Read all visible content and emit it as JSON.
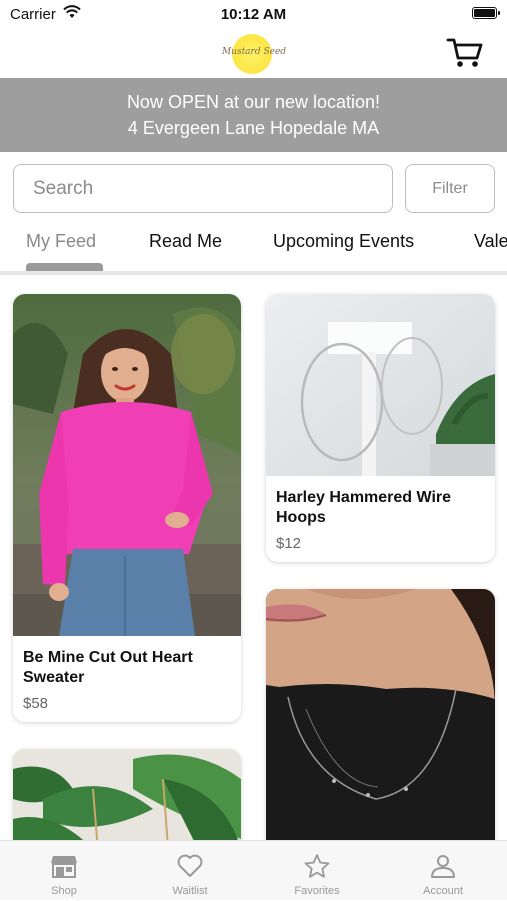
{
  "status_bar": {
    "carrier": "Carrier",
    "time": "10:12 AM"
  },
  "header": {
    "logo_text": "Mustard Seed",
    "cart_icon": "cart-icon"
  },
  "banner": {
    "line1": "Now OPEN at our new location!",
    "line2": "4 Evergeen Lane Hopedale MA"
  },
  "search": {
    "placeholder": "Search",
    "filter_label": "Filter"
  },
  "tabs": [
    {
      "label": "My Feed",
      "active": true
    },
    {
      "label": "Read Me",
      "active": false
    },
    {
      "label": "Upcoming Events",
      "active": false
    },
    {
      "label": "Vale",
      "active": false
    }
  ],
  "products": [
    {
      "title": "Be Mine Cut Out Heart Sweater",
      "price": "$58"
    },
    {
      "title": "Harley Hammered Wire Hoops",
      "price": "$12"
    }
  ],
  "bottom_nav": [
    {
      "label": "Shop",
      "icon": "shop-icon"
    },
    {
      "label": "Waitlist",
      "icon": "heart-icon"
    },
    {
      "label": "Favorites",
      "icon": "star-icon"
    },
    {
      "label": "Account",
      "icon": "account-icon"
    }
  ],
  "colors": {
    "banner_bg": "#9e9e9e",
    "accent_gray": "#9a9a9a",
    "sweater_pink": "#f03fb5"
  }
}
